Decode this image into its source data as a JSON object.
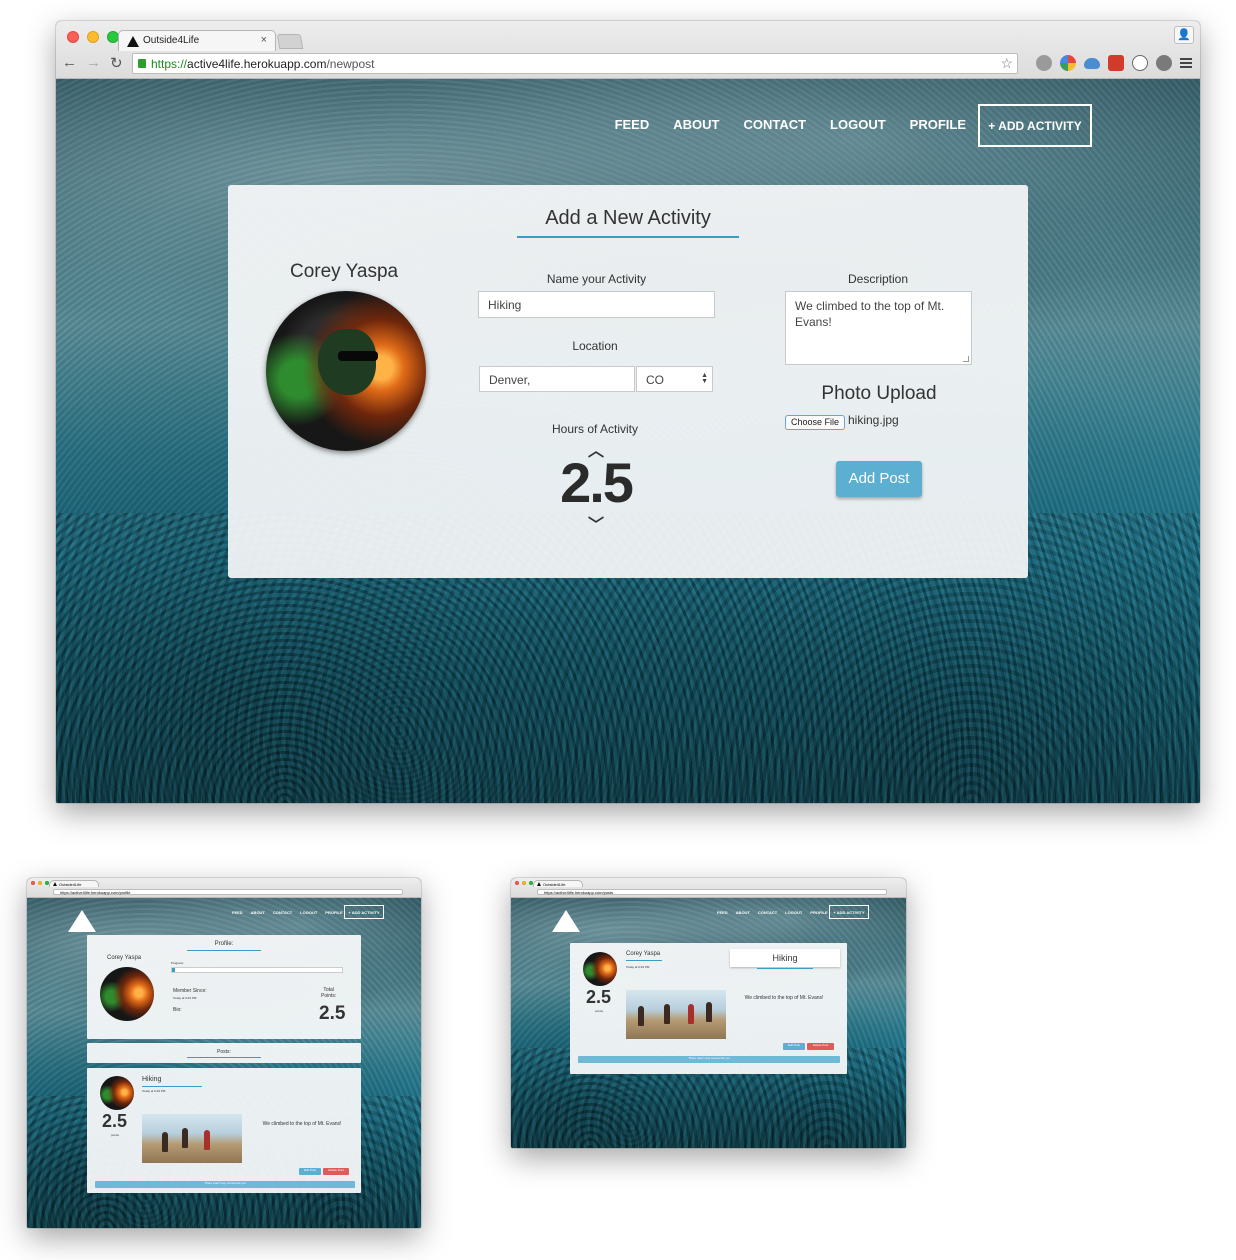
{
  "browser": {
    "tab_title": "Outside4Life",
    "url_protocol": "https://",
    "url_host": "active4life.herokuapp.com",
    "url_path": "/newpost"
  },
  "nav": {
    "feed": "FEED",
    "about": "ABOUT",
    "contact": "CONTACT",
    "logout": "LOGOUT",
    "profile": "PROFILE",
    "add_activity": "+ ADD ACTIVITY"
  },
  "form": {
    "title": "Add a New Activity",
    "user_name": "Corey Yaspa",
    "name_label": "Name your Activity",
    "name_value": "Hiking",
    "location_label": "Location",
    "city_value": "Denver,",
    "state_value": "CO",
    "hours_label": "Hours of Activity",
    "hours_value": "2.5",
    "description_label": "Description",
    "description_value": "We climbed to the top of Mt. Evans!",
    "photo_title": "Photo Upload",
    "choose_file": "Choose File",
    "file_name": "hiking.jpg",
    "add_post": "Add Post"
  },
  "profile_page": {
    "url": "https://active4life.herokuapp.com/profile",
    "section_title": "Profile:",
    "user_name": "Corey Yaspa",
    "progress_label": "Progress:",
    "member_since_label": "Member Since:",
    "member_since_value": "Today at 9:49 PM",
    "bio_label": "Bio:",
    "total_points_label_1": "Total",
    "total_points_label_2": "Points:",
    "total_points_value": "2.5",
    "posts_title": "Posts:",
    "post": {
      "activity": "Hiking",
      "time": "Today at 9:49 PM",
      "points": "2.5",
      "points_label": "points",
      "description": "We climbed to the top of Mt. Evans!",
      "edit": "Edit Post",
      "delete": "Delete Post",
      "comments": "There aren't any comments yet"
    }
  },
  "post_page": {
    "url": "https://active4life.herokuapp.com/posts",
    "user_name": "Corey Yaspa",
    "time": "Today at 9:49 PM",
    "points": "2.5",
    "points_label": "points",
    "activity": "Hiking",
    "description": "We climbed to the top of Mt. Evans!",
    "edit": "Edit Post",
    "delete": "Delete Post",
    "comments": "There aren't any comments yet"
  },
  "colors": {
    "accent": "#3a9dc4",
    "add_post_button": "#5dafd2",
    "delete_button": "#e05a5a",
    "background_tint": "#1a7892"
  }
}
